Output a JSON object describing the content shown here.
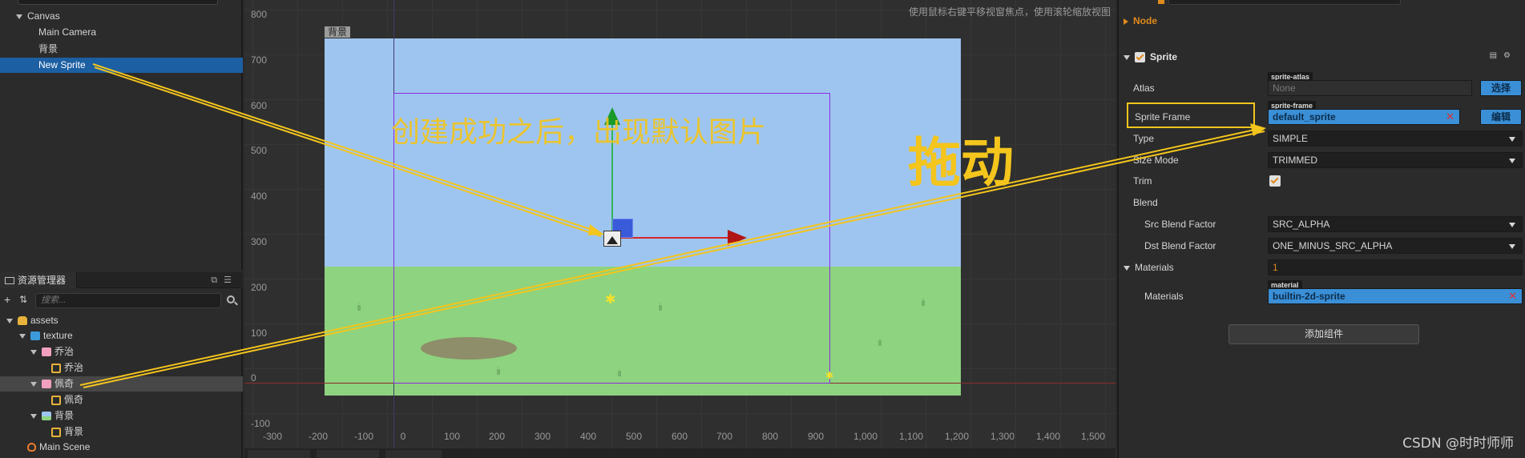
{
  "hierarchy": {
    "items": [
      {
        "label": "Canvas",
        "level": 0,
        "expanded": true
      },
      {
        "label": "Main Camera",
        "level": 1
      },
      {
        "label": "背景",
        "level": 1
      },
      {
        "label": "New Sprite",
        "level": 1,
        "selected": true
      }
    ]
  },
  "assets": {
    "tab_label": "资源管理器",
    "search_placeholder": "搜索...",
    "items": [
      {
        "label": "assets",
        "level": 0,
        "icon": "database-icon"
      },
      {
        "label": "texture",
        "level": 1,
        "icon": "folder-icon"
      },
      {
        "label": "乔治",
        "level": 2,
        "icon": "character-image-icon"
      },
      {
        "label": "乔治",
        "level": 3,
        "icon": "sprite-frame-icon"
      },
      {
        "label": "佩奇",
        "level": 2,
        "icon": "character-image-icon",
        "highlighted": true
      },
      {
        "label": "佩奇",
        "level": 3,
        "icon": "sprite-frame-icon"
      },
      {
        "label": "背景",
        "level": 2,
        "icon": "background-image-icon"
      },
      {
        "label": "背景",
        "level": 3,
        "icon": "sprite-frame-icon"
      },
      {
        "label": "Main Scene",
        "level": 1,
        "icon": "scene-icon"
      }
    ]
  },
  "scene": {
    "hint": "使用鼠标右键平移视窗焦点，使用滚轮缩放视图",
    "canvas_tag": "背景",
    "y_labels": [
      "800",
      "700",
      "600",
      "500",
      "400",
      "300",
      "200",
      "100",
      "0",
      "-100"
    ],
    "x_labels": [
      "-300",
      "-200",
      "-100",
      "0",
      "100",
      "200",
      "300",
      "400",
      "500",
      "600",
      "700",
      "800",
      "900",
      "1,000",
      "1,100",
      "1,200",
      "1,300",
      "1,400",
      "1,500"
    ],
    "annotation_small": "创建成功之后，出现默认图片",
    "annotation_big": "拖动"
  },
  "inspector": {
    "node_section": "Node",
    "sprite_section": "Sprite",
    "atlas": {
      "label": "Atlas",
      "tag": "sprite-atlas",
      "value": "None",
      "button": "选择"
    },
    "sprite_frame": {
      "label": "Sprite Frame",
      "tag": "sprite-frame",
      "value": "default_sprite",
      "button": "编辑"
    },
    "type": {
      "label": "Type",
      "value": "SIMPLE"
    },
    "size_mode": {
      "label": "Size Mode",
      "value": "TRIMMED"
    },
    "trim": {
      "label": "Trim",
      "checked": true
    },
    "blend": {
      "label": "Blend"
    },
    "src_blend": {
      "label": "Src Blend Factor",
      "value": "SRC_ALPHA"
    },
    "dst_blend": {
      "label": "Dst Blend Factor",
      "value": "ONE_MINUS_SRC_ALPHA"
    },
    "materials_header": {
      "label": "Materials",
      "value": "1"
    },
    "materials_item": {
      "label": "Materials",
      "tag": "material",
      "value": "builtin-2d-sprite"
    },
    "add_component": "添加组件"
  },
  "watermark": "CSDN @时时师师",
  "colors": {
    "annotation": "#f4c51c",
    "selection": "#1c5fa3",
    "accent": "#e08b1c",
    "field_blue": "#3a8fd6"
  }
}
